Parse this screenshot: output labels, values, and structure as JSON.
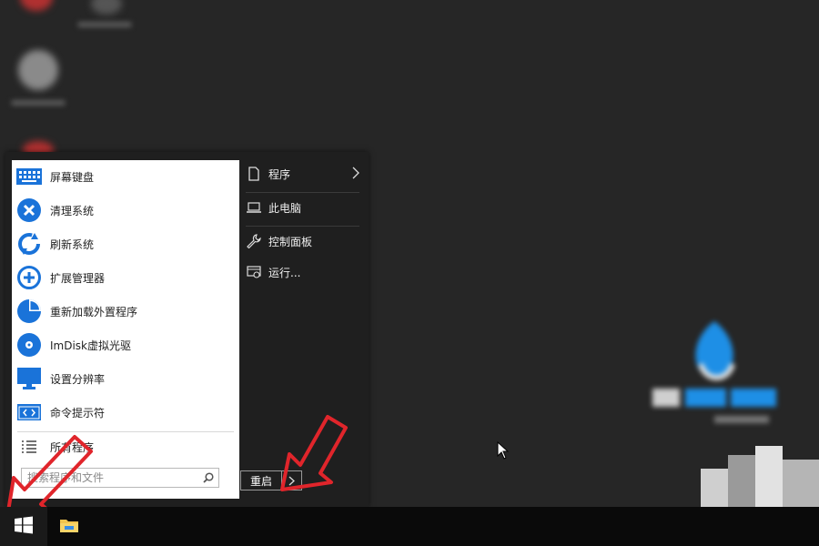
{
  "start_menu": {
    "apps": [
      {
        "label": "屏幕键盘",
        "icon": "keyboard-icon"
      },
      {
        "label": "清理系统",
        "icon": "close-circle-icon"
      },
      {
        "label": "刷新系统",
        "icon": "refresh-icon"
      },
      {
        "label": "扩展管理器",
        "icon": "plus-circle-icon"
      },
      {
        "label": "重新加载外置程序",
        "icon": "pie-chart-icon"
      },
      {
        "label": "ImDisk虚拟光驱",
        "icon": "disc-icon"
      },
      {
        "label": "设置分辨率",
        "icon": "monitor-icon"
      },
      {
        "label": "命令提示符",
        "icon": "terminal-icon"
      }
    ],
    "all_programs": {
      "label": "所有程序",
      "icon": "list-icon"
    },
    "search": {
      "placeholder": "搜索程序和文件",
      "icon": "search-icon"
    },
    "places": [
      {
        "label": "程序",
        "icon": "document-icon",
        "has_submenu": true
      },
      {
        "label": "此电脑",
        "icon": "laptop-icon",
        "has_submenu": false
      },
      {
        "label": "控制面板",
        "icon": "wrench-icon",
        "has_submenu": false
      },
      {
        "label": "运行...",
        "icon": "run-icon",
        "has_submenu": false
      }
    ],
    "power": {
      "label": "重启",
      "more_icon": "chevron-right-icon"
    }
  },
  "taskbar": {
    "start_icon": "windows-logo-icon",
    "pinned": [
      {
        "icon": "file-explorer-icon"
      }
    ]
  },
  "colors": {
    "desktop": "#262626",
    "menu_dark": "#1f1f1f",
    "accent_blue": "#1a73d9",
    "taskbar": "#0a0a0a",
    "annotation_red": "#e0252b"
  }
}
